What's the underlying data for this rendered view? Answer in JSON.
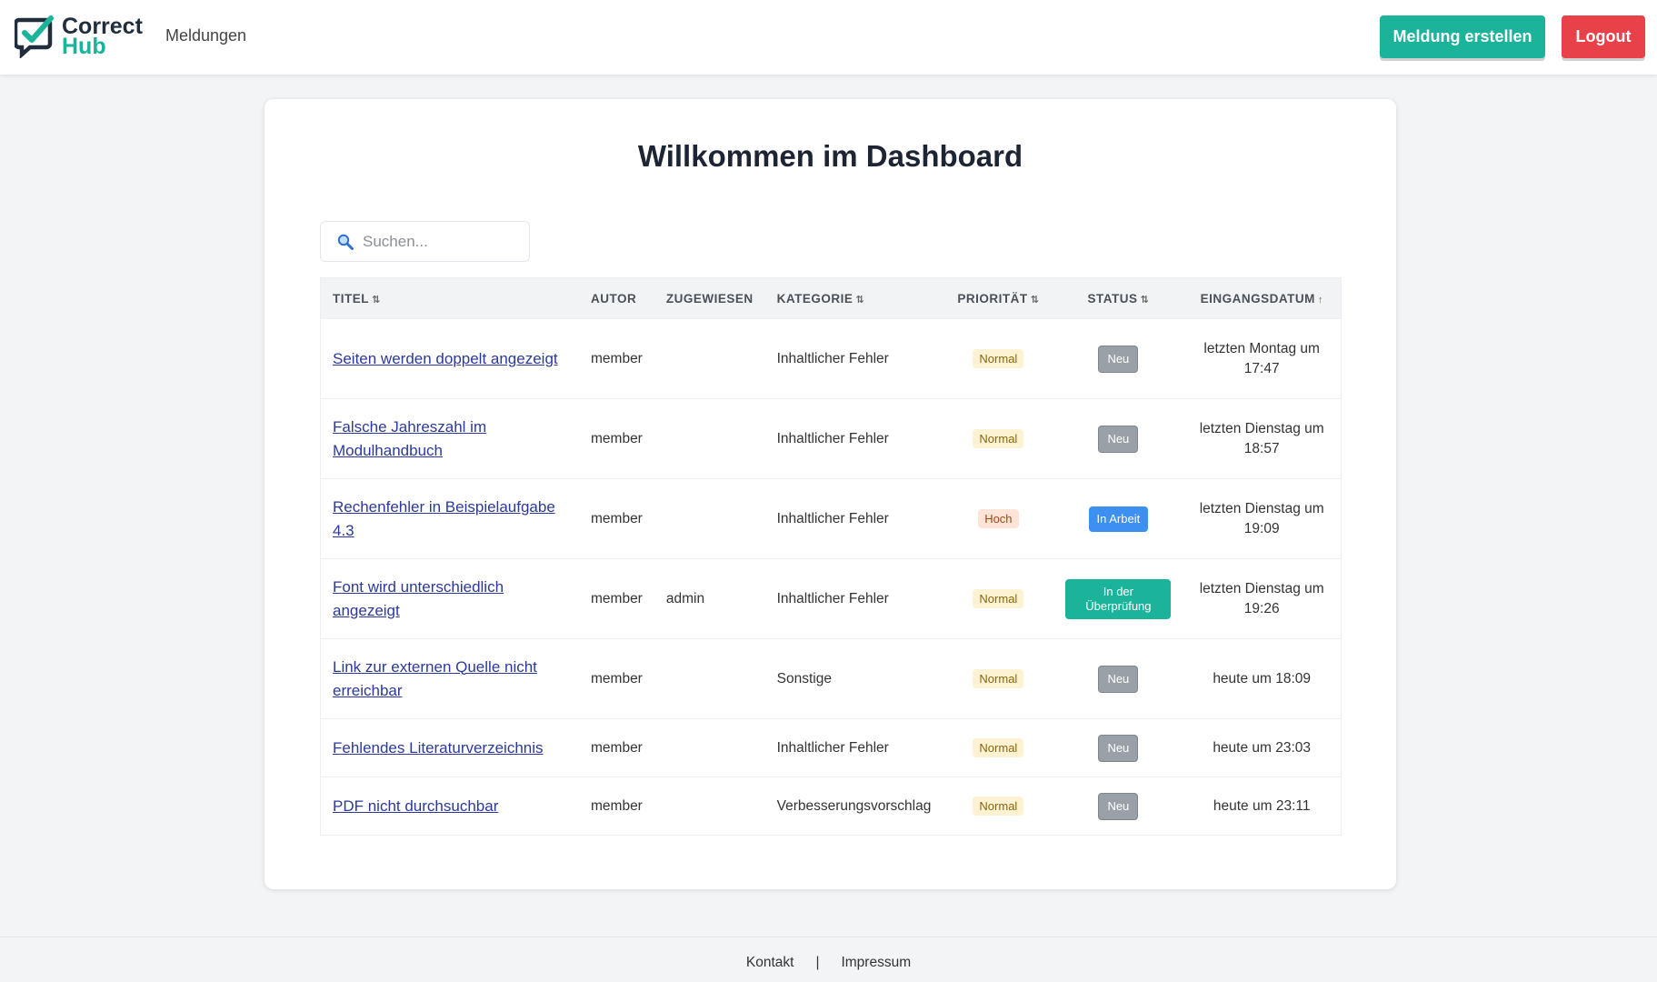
{
  "brand": {
    "line1": "Correct",
    "line2": "Hub"
  },
  "nav": {
    "meldungen": "Meldungen"
  },
  "buttons": {
    "create": "Meldung erstellen",
    "logout": "Logout"
  },
  "page": {
    "title": "Willkommen im Dashboard"
  },
  "search": {
    "placeholder": "Suchen..."
  },
  "table": {
    "headers": {
      "titel": "TITEL",
      "autor": "AUTOR",
      "zugewiesen": "ZUGEWIESEN",
      "kategorie": "KATEGORIE",
      "prioritaet": "PRIORITÄT",
      "status": "STATUS",
      "eingangsdatum": "EINGANGSDATUM"
    },
    "rows": [
      {
        "title": "Seiten werden doppelt angezeigt",
        "author": "member",
        "assigned": "",
        "category": "Inhaltlicher Fehler",
        "priority": "Normal",
        "status": "Neu",
        "date": "letzten Montag um 17:47"
      },
      {
        "title": "Falsche Jahreszahl im Modulhandbuch",
        "author": "member",
        "assigned": "",
        "category": "Inhaltlicher Fehler",
        "priority": "Normal",
        "status": "Neu",
        "date": "letzten Dienstag um 18:57"
      },
      {
        "title": "Rechenfehler in Beispielaufgabe 4.3",
        "author": "member",
        "assigned": "",
        "category": "Inhaltlicher Fehler",
        "priority": "Hoch",
        "status": "In Arbeit",
        "date": "letzten Dienstag um 19:09"
      },
      {
        "title": "Font wird unterschiedlich angezeigt",
        "author": "member",
        "assigned": "admin",
        "category": "Inhaltlicher Fehler",
        "priority": "Normal",
        "status": "In der Überprüfung",
        "date": "letzten Dienstag um 19:26"
      },
      {
        "title": "Link zur externen Quelle nicht erreichbar",
        "author": "member",
        "assigned": "",
        "category": "Sonstige",
        "priority": "Normal",
        "status": "Neu",
        "date": "heute um 18:09"
      },
      {
        "title": "Fehlendes Literaturverzeichnis",
        "author": "member",
        "assigned": "",
        "category": "Inhaltlicher Fehler",
        "priority": "Normal",
        "status": "Neu",
        "date": "heute um 23:03"
      },
      {
        "title": "PDF nicht durchsuchbar",
        "author": "member",
        "assigned": "",
        "category": "Verbesserungsvorschlag",
        "priority": "Normal",
        "status": "Neu",
        "date": "heute um 23:11"
      }
    ]
  },
  "footer": {
    "kontakt": "Kontakt",
    "separator": "|",
    "impressum": "Impressum"
  },
  "colors": {
    "brand_teal": "#1cb39b",
    "logout_red": "#e8414a",
    "link_blue": "#2b3a9a"
  }
}
